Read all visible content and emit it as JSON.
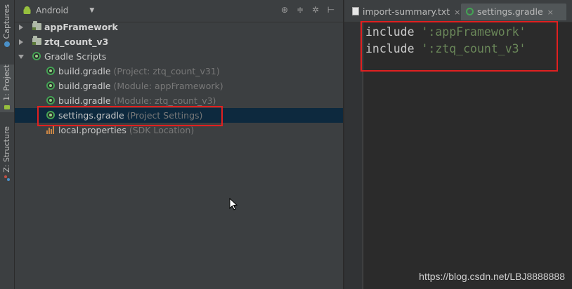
{
  "toolstrip": {
    "tabs": [
      {
        "label": "Captures"
      },
      {
        "label": "1: Project"
      },
      {
        "label": "Z: Structure"
      }
    ]
  },
  "project_panel": {
    "view_selector": "Android",
    "tree": [
      {
        "name": "appFramework",
        "hint": ""
      },
      {
        "name": "ztq_count_v3",
        "hint": ""
      },
      {
        "name": "Gradle Scripts",
        "hint": ""
      },
      {
        "name": "build.gradle",
        "hint": "(Project: ztq_count_v31)"
      },
      {
        "name": "build.gradle",
        "hint": "(Module: appFramework)"
      },
      {
        "name": "build.gradle",
        "hint": "(Module: ztq_count_v3)"
      },
      {
        "name": "settings.gradle",
        "hint": "(Project Settings)"
      },
      {
        "name": "local.properties",
        "hint": "(SDK Location)"
      }
    ]
  },
  "editor": {
    "tabs": [
      {
        "label": "import-summary.txt",
        "close": "×"
      },
      {
        "label": "settings.gradle",
        "close": "×"
      }
    ],
    "lines": [
      {
        "keyword": "include",
        "string": "':appFramework'"
      },
      {
        "keyword": "include",
        "string": "':ztq_count_v3'"
      }
    ]
  },
  "watermark": "https://blog.csdn.net/LBJ8888888",
  "colors": {
    "accent_highlight": "#e02020",
    "selection": "#0d293e",
    "string": "#6a8759"
  }
}
